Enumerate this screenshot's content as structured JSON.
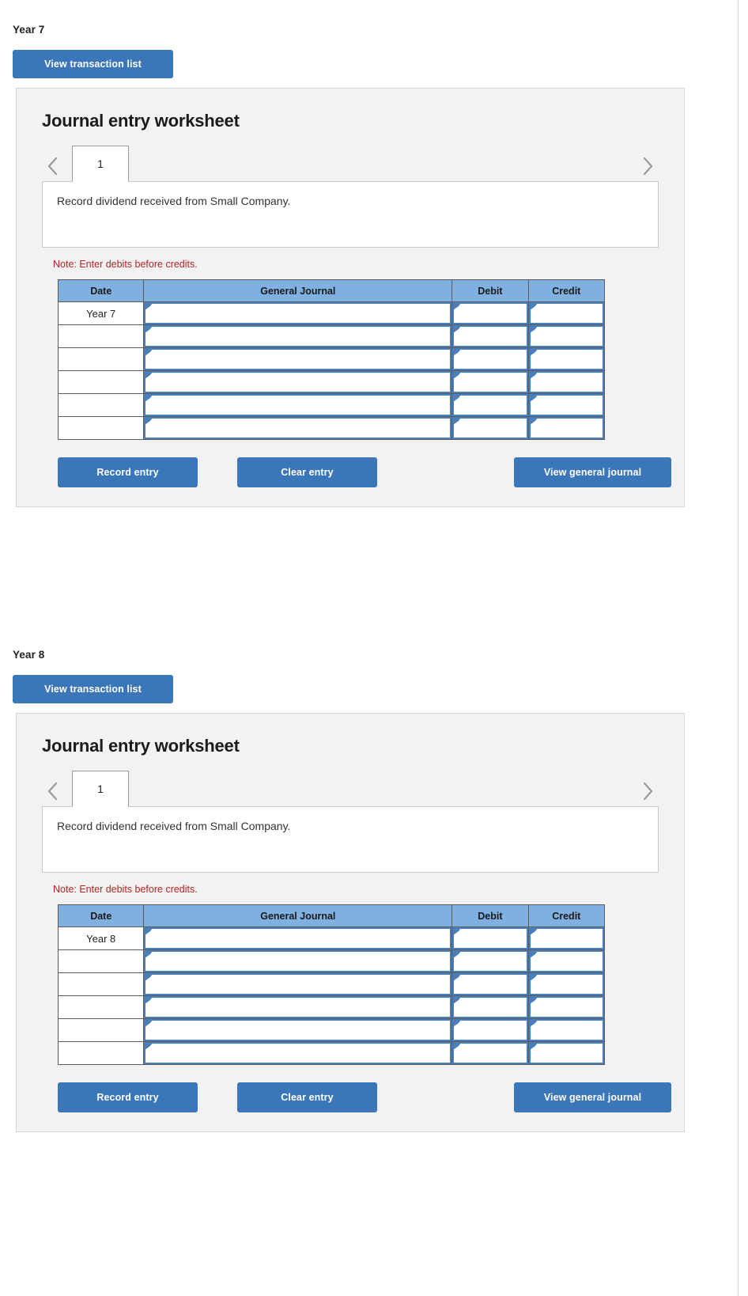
{
  "sections": [
    {
      "section_label": "Year 7",
      "view_transaction_list_label": "View transaction list",
      "panel_heading": "Journal entry worksheet",
      "pager": {
        "prev_icon": "chevron-left-icon",
        "next_icon": "chevron-right-icon",
        "current_tab": "1"
      },
      "description": "Record dividend received from Small Company.",
      "note": "Note: Enter debits before credits.",
      "table": {
        "headers": [
          "Date",
          "General Journal",
          "Debit",
          "Credit"
        ],
        "rows": [
          {
            "date": "Year 7",
            "general_journal": "",
            "debit": "",
            "credit": ""
          },
          {
            "date": "",
            "general_journal": "",
            "debit": "",
            "credit": ""
          },
          {
            "date": "",
            "general_journal": "",
            "debit": "",
            "credit": ""
          },
          {
            "date": "",
            "general_journal": "",
            "debit": "",
            "credit": ""
          },
          {
            "date": "",
            "general_journal": "",
            "debit": "",
            "credit": ""
          },
          {
            "date": "",
            "general_journal": "",
            "debit": "",
            "credit": ""
          }
        ]
      },
      "actions": {
        "record_entry": "Record entry",
        "clear_entry": "Clear entry",
        "view_general_journal": "View general journal"
      }
    },
    {
      "section_label": "Year 8",
      "view_transaction_list_label": "View transaction list",
      "panel_heading": "Journal entry worksheet",
      "pager": {
        "prev_icon": "chevron-left-icon",
        "next_icon": "chevron-right-icon",
        "current_tab": "1"
      },
      "description": "Record dividend received from Small Company.",
      "note": "Note: Enter debits before credits.",
      "table": {
        "headers": [
          "Date",
          "General Journal",
          "Debit",
          "Credit"
        ],
        "rows": [
          {
            "date": "Year 8",
            "general_journal": "",
            "debit": "",
            "credit": ""
          },
          {
            "date": "",
            "general_journal": "",
            "debit": "",
            "credit": ""
          },
          {
            "date": "",
            "general_journal": "",
            "debit": "",
            "credit": ""
          },
          {
            "date": "",
            "general_journal": "",
            "debit": "",
            "credit": ""
          },
          {
            "date": "",
            "general_journal": "",
            "debit": "",
            "credit": ""
          },
          {
            "date": "",
            "general_journal": "",
            "debit": "",
            "credit": ""
          }
        ]
      },
      "actions": {
        "record_entry": "Record entry",
        "clear_entry": "Clear entry",
        "view_general_journal": "View general journal"
      }
    }
  ],
  "colors": {
    "button_blue": "#3a76b8",
    "table_header_blue": "#7fb0e0",
    "input_border_blue": "#4a7fba",
    "panel_background": "#f2f2f2",
    "note_red": "#b52424",
    "chevron_gray": "#9a9a9a"
  },
  "layout": {
    "section_tops": [
      30,
      820
    ]
  }
}
